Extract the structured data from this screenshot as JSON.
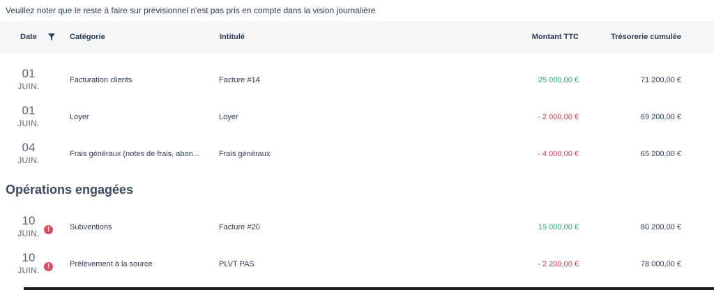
{
  "notice": "Veuillez noter que le reste à faire sur prévisionnel n'est pas pris en compte dans la vision journalière",
  "table": {
    "headers": {
      "date": "Date",
      "categorie": "Catégorie",
      "intitule": "Intitulé",
      "montant": "Montant TTC",
      "tresorerie": "Trésorerie cumulée"
    }
  },
  "rows": [
    {
      "day": "01",
      "month": "JUIN.",
      "categorie": "Facturation clients",
      "intitule": "Facture #14",
      "montant": "25 000,00 €",
      "tresorerie": "71 200,00 €"
    },
    {
      "day": "01",
      "month": "JUIN.",
      "categorie": "Loyer",
      "intitule": "Loyer",
      "montant": "- 2 000,00 €",
      "tresorerie": "69 200,00 €"
    },
    {
      "day": "04",
      "month": "JUIN.",
      "categorie": "Frais généraux (notes de frais, abon...",
      "intitule": "Frais généraux",
      "montant": "- 4 000,00 €",
      "tresorerie": "65 200,00 €"
    }
  ],
  "section_engaged": {
    "title": "Opérations engagées",
    "rows": [
      {
        "day": "10",
        "month": "JUIN.",
        "categorie": "Subventions",
        "intitule": "Facture #20",
        "montant": "15 000,00 €",
        "tresorerie": "80 200,00 €"
      },
      {
        "day": "10",
        "month": "JUIN.",
        "categorie": "Prélèvement à la source",
        "intitule": "PLVT PAS",
        "montant": "- 2 200,00 €",
        "tresorerie": "78 000,00 €"
      }
    ]
  },
  "icons": {
    "filter": "filter-icon",
    "alert": "alert-icon"
  },
  "colors": {
    "positive": "#2aa672",
    "negative": "#c8404f",
    "alert": "#d4505e",
    "header_bg": "#f5f6f7"
  }
}
